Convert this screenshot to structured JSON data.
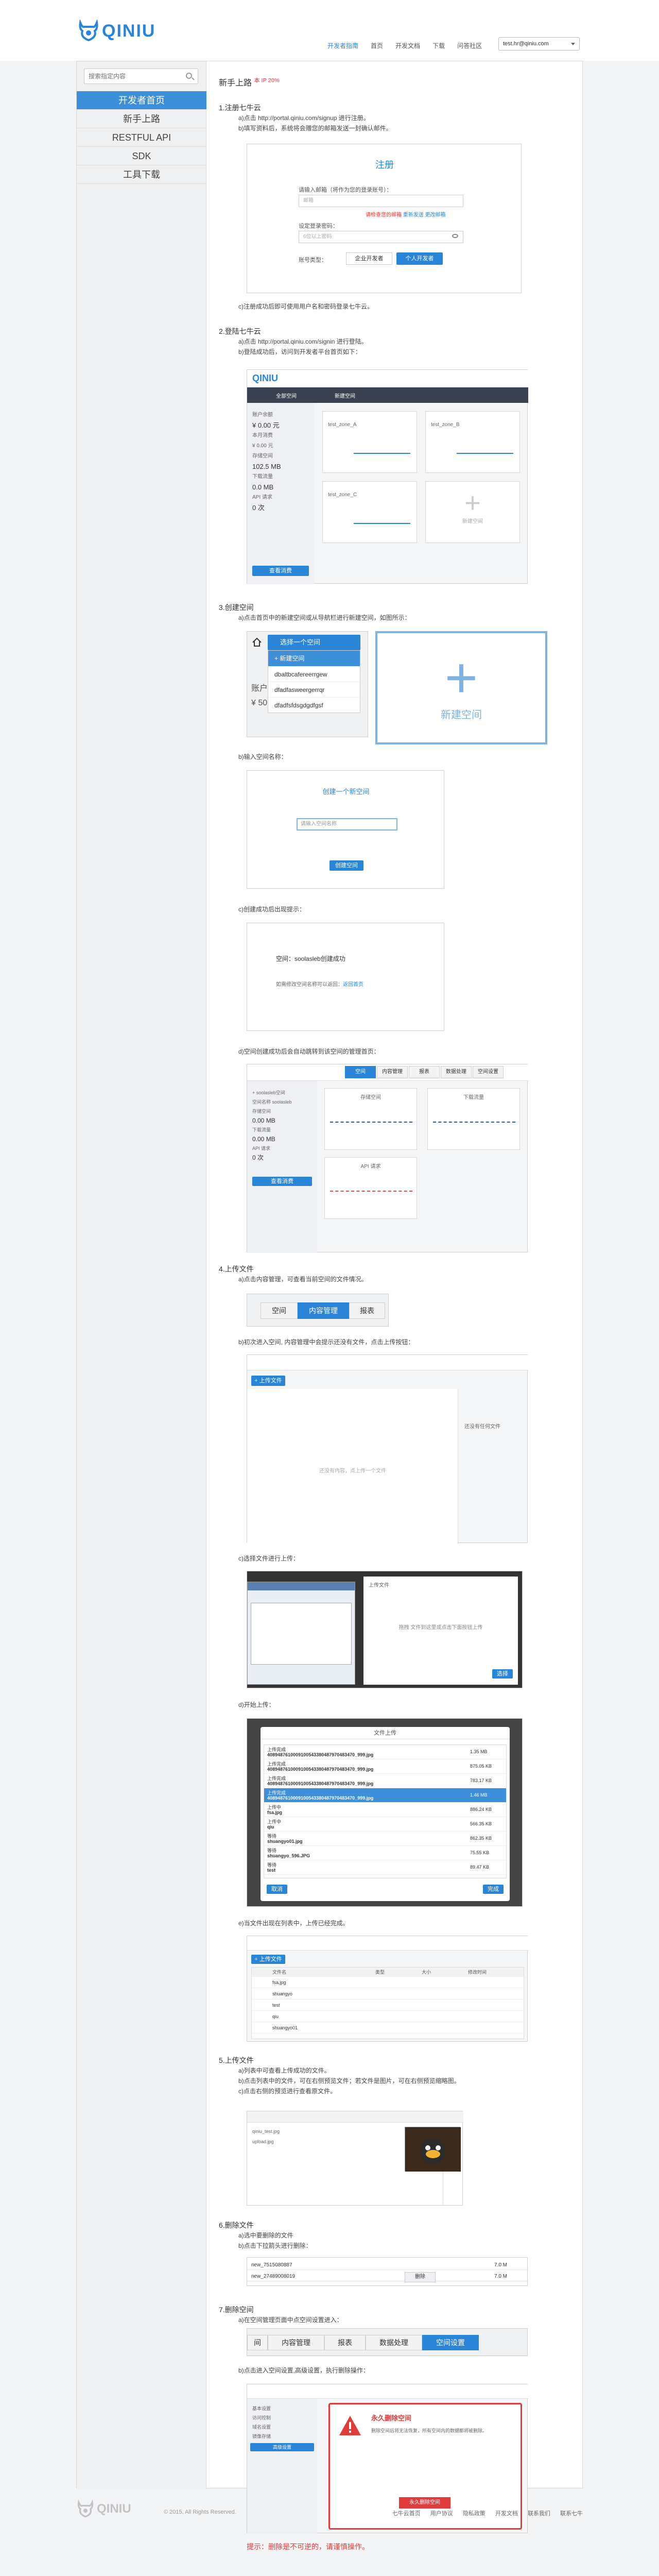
{
  "brand": {
    "name": "QINIU"
  },
  "nav": {
    "items": [
      "开发者指南",
      "首页",
      "开发文档",
      "下载",
      "问答社区"
    ],
    "user": "test.hr@qiniu.com"
  },
  "sidebar": {
    "search_placeholder": "搜索指定内容",
    "items": [
      "开发者首页",
      "新手上路",
      "RESTFUL API",
      "SDK",
      "工具下载"
    ]
  },
  "page": {
    "title": "新手上路",
    "title_sup": "本 IP 20%"
  },
  "sections": {
    "s1": {
      "title": "1.注册七牛云",
      "lines": [
        "a)点击 http://portal.qiniu.com/signup 进行注册。",
        "b)填写资料后，系统将会赠您的邮箱发送一封确认邮件。"
      ],
      "after": "c)注册成功后即可使用用户名和密码登录七牛云。",
      "shot": {
        "heading": "注册",
        "email_label": "请输入邮箱（将作为您的登录账号）：",
        "email_ph": "邮箱",
        "email_hint": "请检查您的邮箱",
        "email_hint_link": "重新发送",
        "email_hint_link2": "更改邮箱",
        "pwd_label": "设定登录密码：",
        "pwd_ph": "6位以上密码",
        "type_label": "账号类型：",
        "type_btn1": "企业开发者",
        "type_btn2": "个人开发者"
      }
    },
    "s2": {
      "title": "2.登陆七牛云",
      "lines": [
        "a)点击 http://portal.qiniu.com/signin 进行登陆。",
        "b)登陆成功后，访问到开发者平台首页如下："
      ],
      "shot": {
        "brand": "QINIU",
        "menu1": "新建空间",
        "menu2": "全部空间",
        "card_names": [
          "test_zone_A",
          "test_zone_B",
          "test_zone_C"
        ],
        "add_label": "新建空间",
        "left_labels": [
          "账户余额",
          "¥ 0.00 元",
          "本月消费",
          "¥ 0.00 元",
          "存储空间",
          "102.5 MB",
          "下载流量",
          "0.0 MB",
          "API 请求",
          "0 次"
        ],
        "left_btn": "查看消费"
      }
    },
    "s3": {
      "title": "3.创建空间",
      "lines": [
        "a)点击首页中的新建空间或从导航栏进行新建空间，如图所示："
      ],
      "dd": {
        "select": "选择一个空间",
        "new": "+ 新建空间",
        "opts": [
          "dbaltbcafereerrgew",
          "dfadfasweergerrqr",
          "dfadfsfdsgdgdfgsf"
        ],
        "left1": "账户",
        "left2": "¥ 50"
      },
      "big_add": "新建空间",
      "b": "b)输入空间名称：",
      "b_shot": {
        "title": "创建一个新空间",
        "ph": "请输入空间名称",
        "btn": "创建空间"
      },
      "c": "c)创建成功后出现提示：",
      "c_shot": {
        "msg": "空间：soolasleb创建成功",
        "sub": "如需修改空间名称可以返回：",
        "link": "返回首页"
      },
      "d": "d)空间创建成功后会自动跳转到该空间的管理首页：",
      "d_shot": {
        "tabs": [
          "空间",
          "内容管理",
          "报表",
          "数据处理",
          "空间设置"
        ],
        "cards": [
          "存储空间",
          "下载流量",
          "API 请求"
        ],
        "left": [
          "+ soolasleb空间",
          "空间名称 soolasleb",
          "存储空间",
          "0.00 MB",
          "下载流量",
          "0.00 MB",
          "API 请求",
          "0 次"
        ],
        "left_btn": "查看消费"
      }
    },
    "s4": {
      "title": "4.上传文件",
      "lines": [
        "a)点击内容管理，可查看当前空间的文件情况。"
      ],
      "tabs": [
        "空间",
        "内容管理",
        "报表"
      ],
      "b": "b)初次进入空间, 内容管理中会提示还没有文件，点击上传按钮：",
      "b_shot": {
        "btn": "+ 上传文件",
        "placeholder": "还没有内容，点上传一个文件",
        "right": "还没有任何文件"
      },
      "c": "c)选择文件进行上传：",
      "c_shot": {
        "dialog_title": "上传文件",
        "dialog_msg": "拖拽 文件到这里或点击下面按钮上传",
        "ok": "选择"
      },
      "d": "d)开始上传：",
      "d_shot": {
        "title": "文件上传",
        "rows": [
          [
            "上传完成",
            "4089487610009100543380487970483470_999.jpg",
            "1.35 MB"
          ],
          [
            "上传完成",
            "4089487610009100543380487970483470_999.jpg",
            "875.05 KB"
          ],
          [
            "上传完成",
            "4089487610009100543380487970483470_999.jpg",
            "783.17 KB"
          ],
          [
            "上传完成",
            "4089487610009100543380487970483470_999.jpg",
            "1.46 MB"
          ],
          [
            "上传中",
            "fsa.jpg",
            "886.24 KB"
          ],
          [
            "上传中",
            "qiu",
            "566.35 KB"
          ],
          [
            "等待",
            "shuangyo01.jpg",
            "862.35 KB"
          ],
          [
            "等待",
            "shuangyo_596.JPG",
            "75.55 KB"
          ],
          [
            "等待",
            "test",
            "89.47 KB"
          ]
        ],
        "cancel": "取消",
        "done": "完成"
      },
      "e": "e)当文件出现在列表中，上传已经完成。",
      "e_shot": {
        "btn": "+ 上传文件",
        "cols": [
          "文件名",
          "类型",
          "大小",
          "修改时间"
        ],
        "rows": [
          "fsa.jpg",
          "shuangyo",
          "test",
          "qiu",
          "shuangyo01"
        ]
      }
    },
    "s5": {
      "title": "5.上传文件",
      "lines": [
        "a)列表中可查看上传成功的文件。",
        "b)点击列表中的文件，可在右侧预览文件；若文件是图片，可在右侧预览缩略图。",
        "c)点击右侧的预览进行查看原文件。"
      ],
      "shot": {
        "file1": "qiniu_test.jpg",
        "file2": "upload.jpg"
      }
    },
    "s6": {
      "title": "6.删除文件",
      "lines": [
        "a)选中要删除的文件",
        "b)点击下拉箭头进行删除："
      ],
      "shot": {
        "rows": [
          "new_7515080887",
          "new_27489008019"
        ],
        "action": "删除",
        "size1": "7.0 M",
        "size2": "7.0 M"
      }
    },
    "s7": {
      "title": "7.删除空间",
      "lines": [
        "a)在空间管理页面中点空间设置进入："
      ],
      "tabs": [
        "间",
        "内容管理",
        "报表",
        "数据处理",
        "空间设置"
      ],
      "b": "b)点击进入空间设置,高级设置，执行删除操作：",
      "b_shot": {
        "left": [
          "基本设置",
          "访问控制",
          "域名设置",
          "镜像存储",
          "高级设置"
        ],
        "warn_title": "永久删除空间",
        "warn_text": "删除空间后将无法恢复，所有空间内的数据都将被删除。",
        "warn_btn": "永久删除空间"
      },
      "tip": "提示：删除是不可逆的，请谨慎操作。"
    }
  },
  "footer": {
    "copy": "© 2015, All Rights Reserved.",
    "links": [
      "七牛云首页",
      "用户协议",
      "隐私政策",
      "开发文档",
      "联系我们",
      "联系七牛"
    ]
  }
}
